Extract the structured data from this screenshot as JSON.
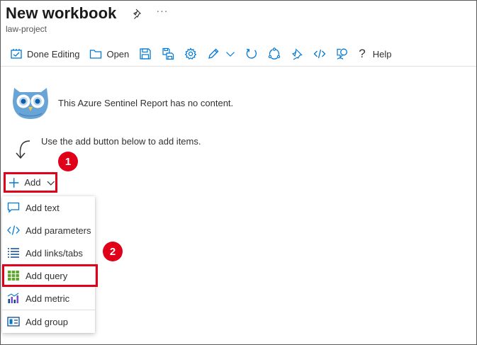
{
  "header": {
    "title": "New workbook",
    "subtitle": "law-project",
    "more_label": "···"
  },
  "toolbar": {
    "done_editing": "Done Editing",
    "open": "Open",
    "help": "Help",
    "icons": [
      "edit-done-icon",
      "folder-icon",
      "save-icon",
      "save-as-icon",
      "gear-icon",
      "pencil-icon",
      "chevron-down-icon",
      "refresh-icon",
      "share-icon",
      "pin-icon",
      "code-icon",
      "feedback-icon",
      "help-icon"
    ]
  },
  "empty_state": {
    "message": "This Azure Sentinel Report has no content.",
    "hint": "Use the add button below to add items."
  },
  "add_button": {
    "label": "Add"
  },
  "add_menu": {
    "items": [
      {
        "label": "Add text",
        "icon": "text-bubble-icon"
      },
      {
        "label": "Add parameters",
        "icon": "code-icon"
      },
      {
        "label": "Add links/tabs",
        "icon": "list-icon"
      },
      {
        "label": "Add query",
        "icon": "grid-icon"
      },
      {
        "label": "Add metric",
        "icon": "metric-chart-icon"
      },
      {
        "label": "Add group",
        "icon": "group-icon"
      }
    ]
  },
  "callouts": {
    "step1": "1",
    "step2": "2"
  },
  "colors": {
    "highlight": "#e0001a",
    "icon_blue": "#0078d4",
    "text": "#323130"
  }
}
